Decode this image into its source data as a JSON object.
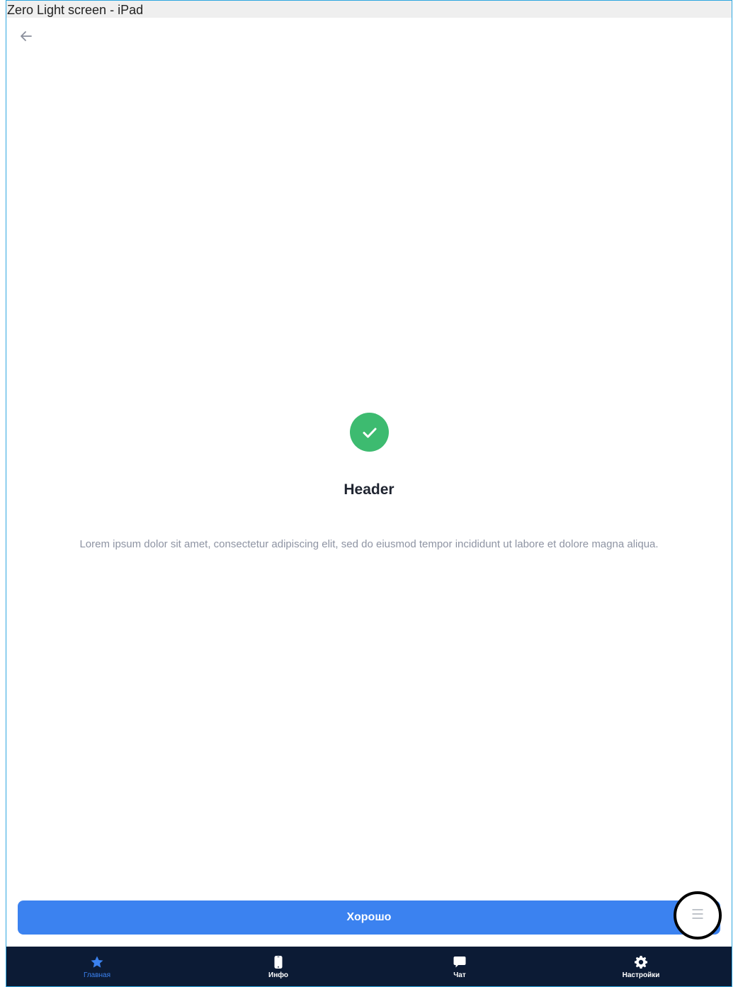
{
  "window": {
    "title": "Zero Light screen - iPad"
  },
  "screen": {
    "back_icon": "arrow-left-icon",
    "status_icon": "check-circle-icon",
    "header": "Header",
    "description": "Lorem ipsum dolor sit amet, consectetur adipiscing elit, sed do eiusmod tempor incididunt ut labore et dolore magna aliqua.",
    "ok_button_label": "Хорошо",
    "fab_icon": "menu-icon"
  },
  "tabbar": {
    "items": [
      {
        "label": "Главная",
        "icon": "star-icon",
        "active": true
      },
      {
        "label": "Инфо",
        "icon": "phone-icon",
        "active": false
      },
      {
        "label": "Чат",
        "icon": "chat-icon",
        "active": false
      },
      {
        "label": "Настройки",
        "icon": "gear-icon",
        "active": false
      }
    ]
  },
  "colors": {
    "accent": "#3b82f0",
    "success": "#3dbb70",
    "tabbar_bg": "#0c1b35",
    "description_text": "#8e94a3",
    "frame_border": "#2ea6df"
  }
}
